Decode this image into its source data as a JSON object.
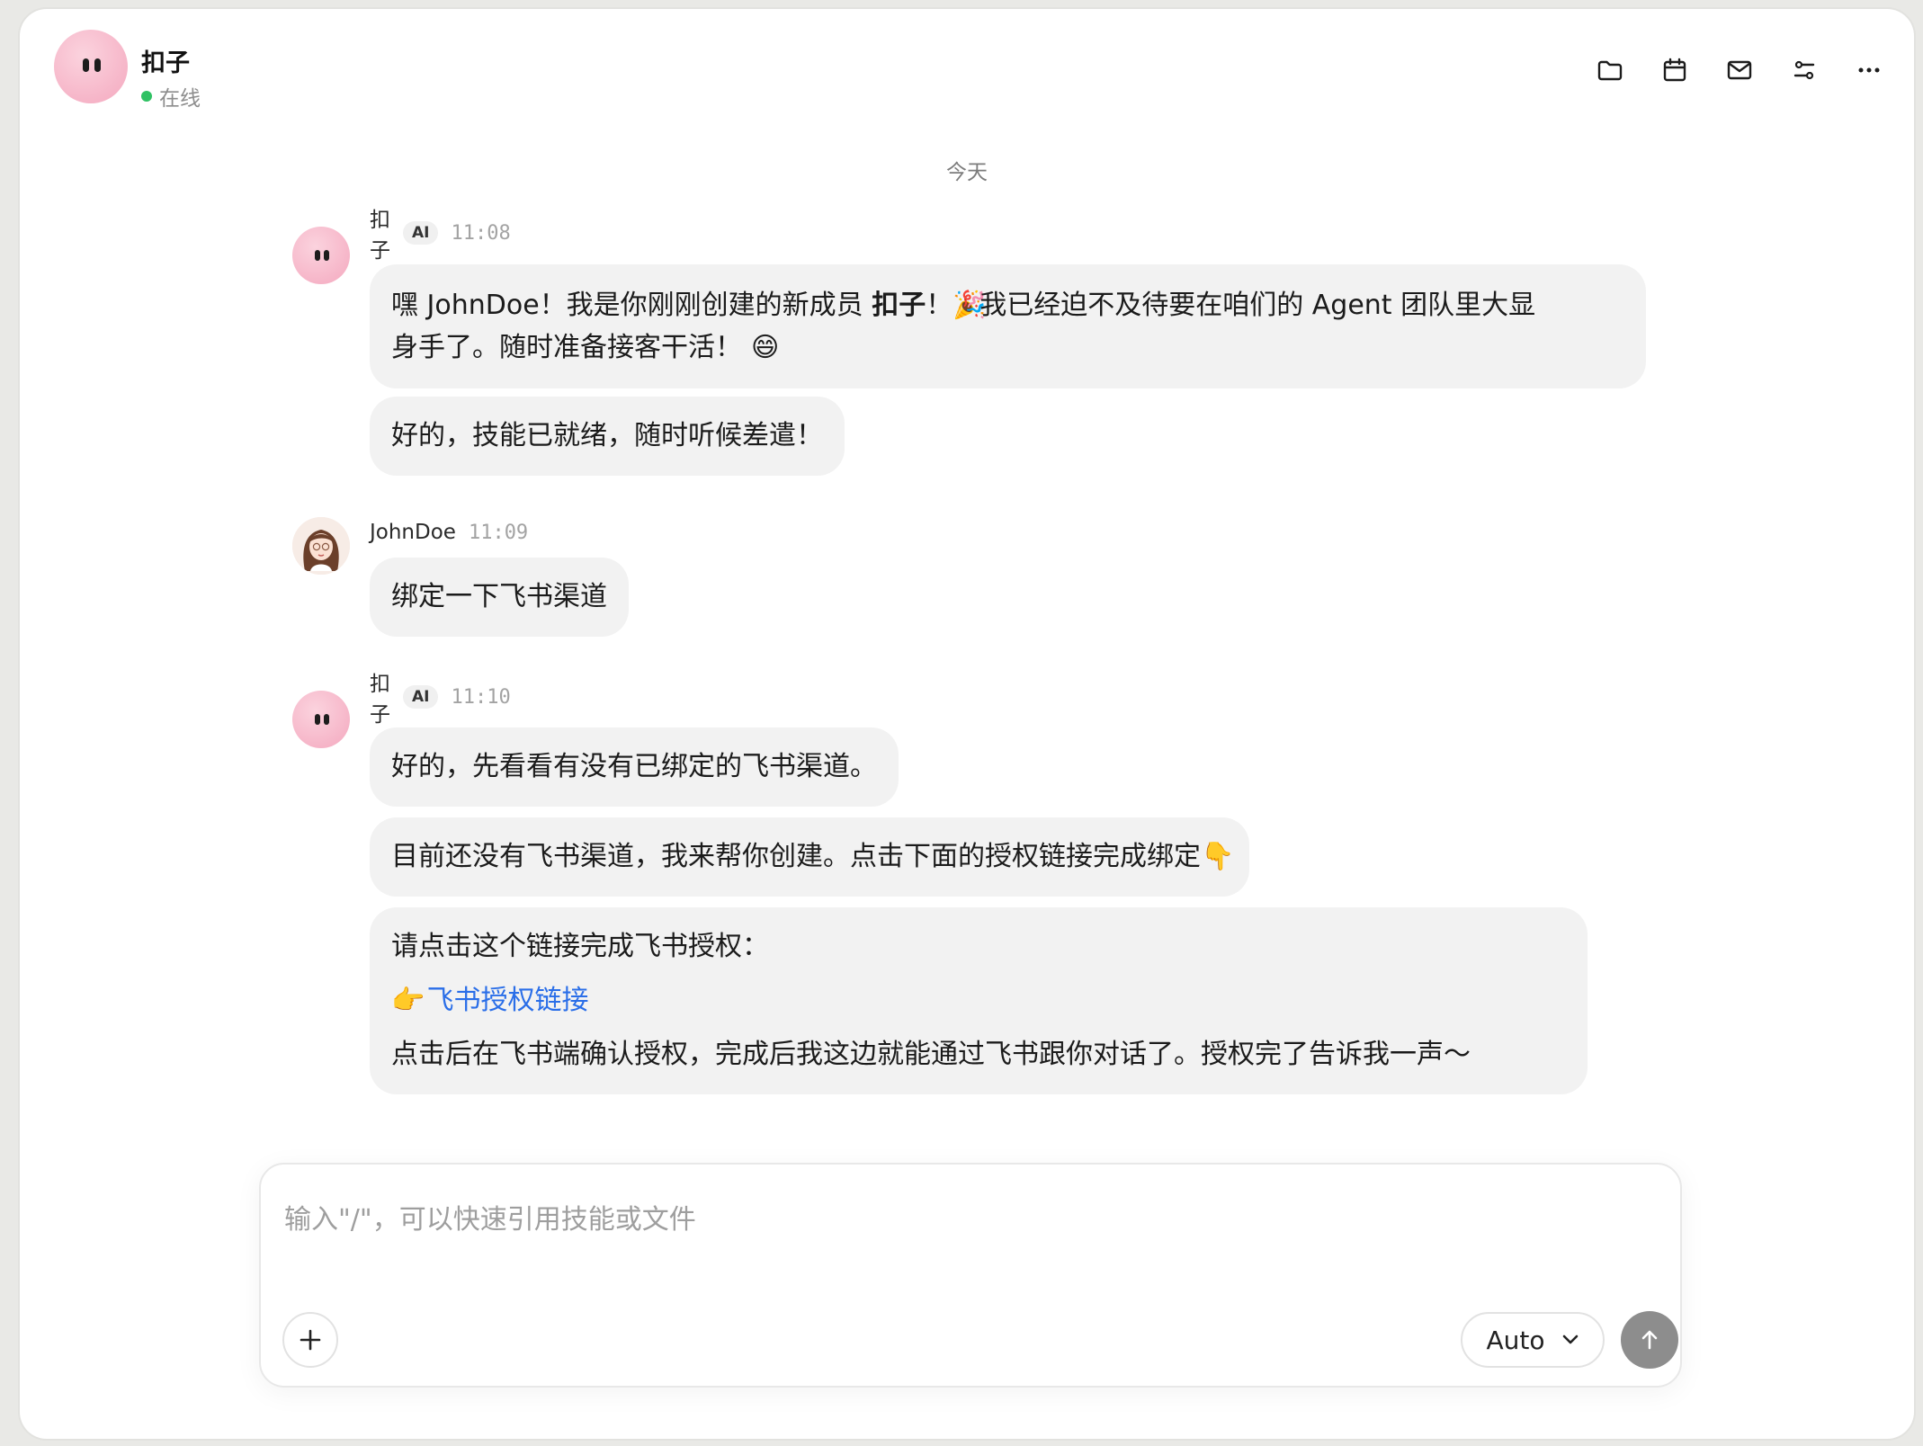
{
  "header": {
    "name": "扣子",
    "status": "在线",
    "icons": [
      "folder-icon",
      "calendar-icon",
      "mail-icon",
      "settings-sliders-icon",
      "more-icon"
    ]
  },
  "date_separator": "今天",
  "messages": [
    {
      "sender": "扣子",
      "badge": "AI",
      "time": "11:08",
      "bubbles": [
        {
          "part1": "嘿 JohnDoe！我是你刚刚创建的新成员 ",
          "bold": "扣子",
          "part2": "！",
          "emoji": "🎉",
          "part3": "我已经迫不及待要在咱们的 Agent 团队里大显",
          "line2": "身手了。随时准备接客干活！",
          "emoji2": "😄"
        },
        {
          "text": "好的，技能已就绪，随时听候差遣！"
        }
      ]
    },
    {
      "sender": "JohnDoe",
      "time": "11:09",
      "bubbles": [
        {
          "text": "绑定一下飞书渠道"
        }
      ]
    },
    {
      "sender": "扣子",
      "badge": "AI",
      "time": "11:10",
      "bubbles": [
        {
          "text": "好的，先看看有没有已绑定的飞书渠道。"
        },
        {
          "text": "目前还没有飞书渠道，我来帮你创建。点击下面的授权链接完成绑定",
          "emoji": "👇"
        },
        {
          "line1": "请点击这个链接完成飞书授权：",
          "pointer": "👉",
          "link": "飞书授权链接",
          "line3": "点击后在飞书端确认授权，完成后我这边就能通过飞书跟你对话了。授权完了告诉我一声～"
        }
      ]
    }
  ],
  "composer": {
    "placeholder": "输入\"/\"，可以快速引用技能或文件",
    "mode": "Auto"
  }
}
